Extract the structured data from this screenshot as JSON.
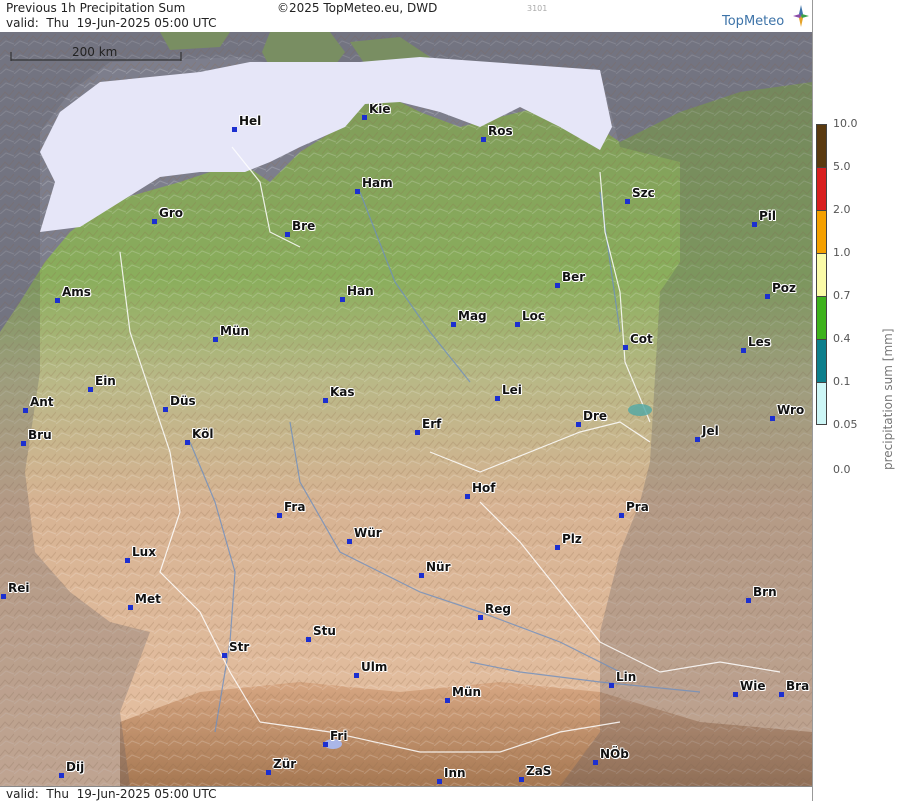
{
  "header": {
    "title": "Previous 1h Precipitation Sum",
    "valid": "valid:  Thu  19-Jun-2025 05:00 UTC",
    "copyright": "©2025 TopMeteo.eu, DWD",
    "image_id": "3101",
    "logo": "TopMeteo"
  },
  "footer": {
    "valid": "valid:  Thu  19-Jun-2025 05:00 UTC"
  },
  "map": {
    "scale_label": "200 km",
    "cities": [
      {
        "label": "Hel"
      },
      {
        "label": "Kie"
      },
      {
        "label": "Ros"
      },
      {
        "label": "Ham"
      },
      {
        "label": "Szc"
      },
      {
        "label": "Gro"
      },
      {
        "label": "Bre"
      },
      {
        "label": "Pil"
      },
      {
        "label": "Ber"
      },
      {
        "label": "Ams"
      },
      {
        "label": "Han"
      },
      {
        "label": "Poz"
      },
      {
        "label": "Mag"
      },
      {
        "label": "Loc"
      },
      {
        "label": "Mün"
      },
      {
        "label": "Cot"
      },
      {
        "label": "Les"
      },
      {
        "label": "Ein"
      },
      {
        "label": "Kas"
      },
      {
        "label": "Lei"
      },
      {
        "label": "Ant"
      },
      {
        "label": "Düs"
      },
      {
        "label": "Wro"
      },
      {
        "label": "Bru"
      },
      {
        "label": "Köl"
      },
      {
        "label": "Erf"
      },
      {
        "label": "Dre"
      },
      {
        "label": "Jel"
      },
      {
        "label": "Hof"
      },
      {
        "label": "Fra"
      },
      {
        "label": "Pra"
      },
      {
        "label": "Wür"
      },
      {
        "label": "Plz"
      },
      {
        "label": "Lux"
      },
      {
        "label": "Nür"
      },
      {
        "label": "Rei"
      },
      {
        "label": "Met"
      },
      {
        "label": "Brn"
      },
      {
        "label": "Reg"
      },
      {
        "label": "Stu"
      },
      {
        "label": "Str"
      },
      {
        "label": "Ulm"
      },
      {
        "label": "Lin"
      },
      {
        "label": "Mün"
      },
      {
        "label": "Wie"
      },
      {
        "label": "Bra"
      },
      {
        "label": "Fri"
      },
      {
        "label": "NÖb"
      },
      {
        "label": "Zür"
      },
      {
        "label": "Dij"
      },
      {
        "label": "Inn"
      },
      {
        "label": "ZaS"
      }
    ]
  },
  "legend": {
    "title": "precipitation sum [mm]",
    "segments": [
      {
        "label": "10.0",
        "color": "#5a3a10"
      },
      {
        "label": "5.0",
        "color": "#d81f1f"
      },
      {
        "label": "2.0",
        "color": "#f5a000"
      },
      {
        "label": "1.0",
        "color": "#fbfba8"
      },
      {
        "label": "0.7",
        "color": "#3db21c"
      },
      {
        "label": "0.4",
        "color": "#0d7f8c"
      },
      {
        "label": "0.1",
        "color": "#cdf6f6"
      },
      {
        "label": "0.05",
        "color": "#ffffff"
      }
    ],
    "zero_label": "0.0"
  },
  "colors": {
    "sea": "#7d7e8c",
    "coverage_mask": "#e6e6f8",
    "lowland": "#6f9450",
    "upland": "#c9a27e",
    "city_dot": "#1c2fd0"
  }
}
